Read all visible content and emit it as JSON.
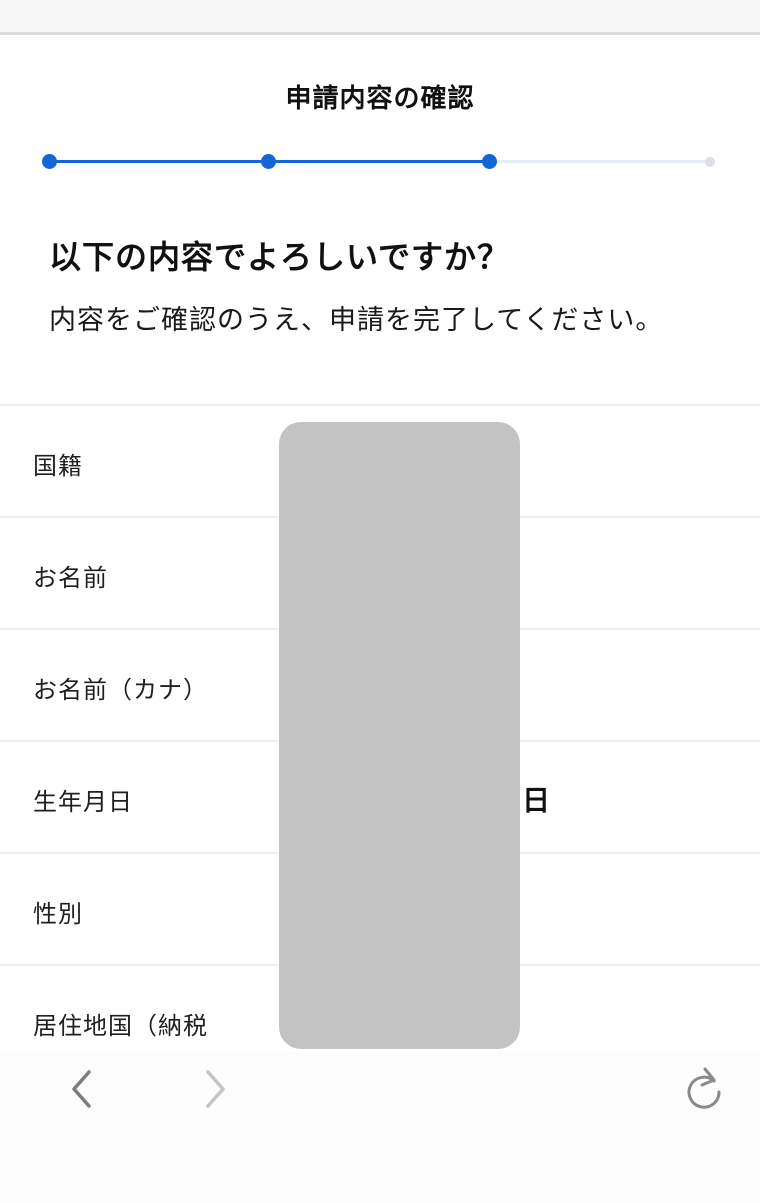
{
  "header": {
    "title": "申請内容の確認"
  },
  "progress": {
    "total_steps": 4,
    "current_step": 3,
    "active_color": "#1565d8",
    "inactive_color": "#e5ecf6"
  },
  "intro": {
    "heading": "以下の内容でよろしいですか？",
    "description": "内容をご確認のうえ、申請を完了してください。"
  },
  "rows": [
    {
      "label": "国籍",
      "value": ""
    },
    {
      "label": "お名前",
      "value": ""
    },
    {
      "label": "お名前（カナ）",
      "value": ""
    },
    {
      "label": "生年月日",
      "value": "日"
    },
    {
      "label": "性別",
      "value": ""
    },
    {
      "label": "居住地国（納税",
      "value": ""
    }
  ],
  "browser_nav": {
    "back_icon": "chevron-left-icon",
    "forward_icon": "chevron-right-icon",
    "reload_icon": "reload-icon"
  }
}
